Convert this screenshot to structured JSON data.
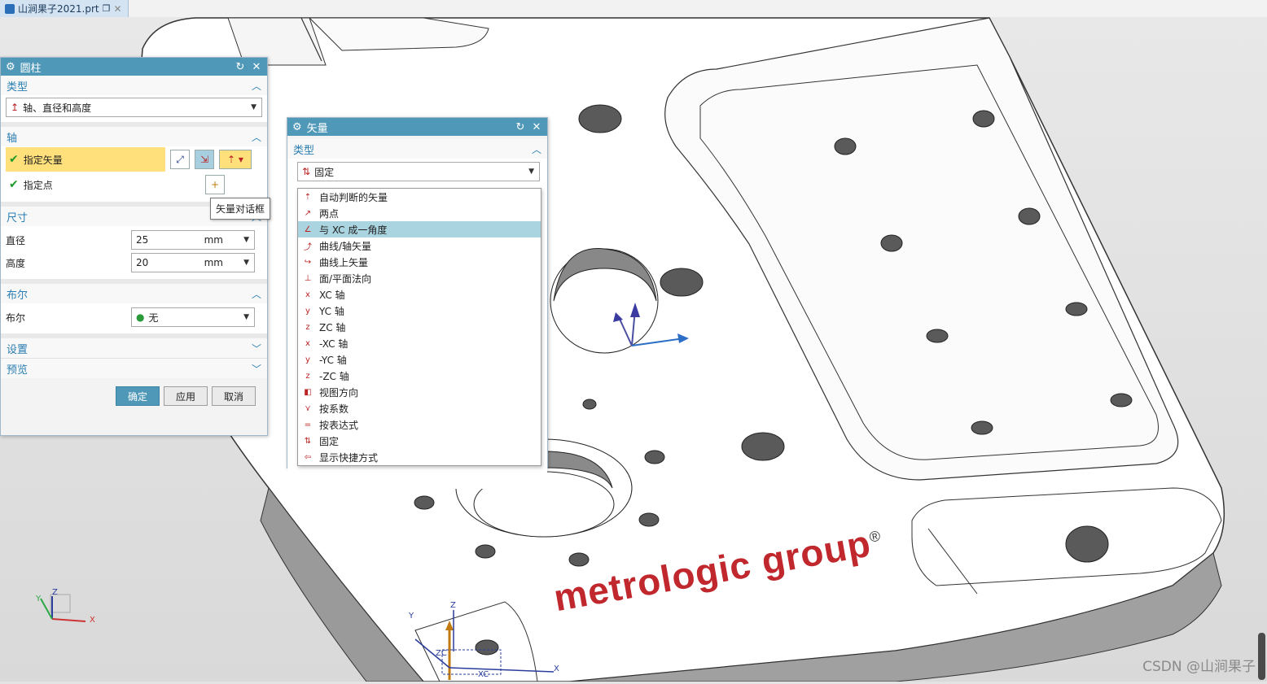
{
  "tab": {
    "title": "山涧果子2021.prt"
  },
  "cylinder_dialog": {
    "title": "圆柱",
    "type_section": "类型",
    "type_value": "轴、直径和高度",
    "axis_section": "轴",
    "specify_vector": "指定矢量",
    "specify_point": "指定点",
    "dims_section": "尺寸",
    "diameter_label": "直径",
    "diameter_value": "25",
    "diameter_unit": "mm",
    "height_label": "高度",
    "height_value": "20",
    "height_unit": "mm",
    "boolean_section": "布尔",
    "boolean_label": "布尔",
    "boolean_value": "无",
    "settings_section": "设置",
    "preview_section": "预览",
    "ok": "确定",
    "apply": "应用",
    "cancel": "取消"
  },
  "tooltip": "矢量对话框",
  "vector_dialog": {
    "title": "矢量",
    "type_section": "类型",
    "type_value": "固定",
    "options": [
      {
        "label": "自动判断的矢量",
        "icon": "auto-vector-icon"
      },
      {
        "label": "两点",
        "icon": "two-points-icon"
      },
      {
        "label": "与 XC 成一角度",
        "icon": "angle-xc-icon"
      },
      {
        "label": "曲线/轴矢量",
        "icon": "curve-axis-icon"
      },
      {
        "label": "曲线上矢量",
        "icon": "on-curve-icon"
      },
      {
        "label": "面/平面法向",
        "icon": "face-normal-icon"
      },
      {
        "label": "XC 轴",
        "icon": "xc-axis-icon"
      },
      {
        "label": "YC 轴",
        "icon": "yc-axis-icon"
      },
      {
        "label": "ZC 轴",
        "icon": "zc-axis-icon"
      },
      {
        "label": "-XC 轴",
        "icon": "neg-xc-axis-icon"
      },
      {
        "label": "-YC 轴",
        "icon": "neg-yc-axis-icon"
      },
      {
        "label": "-ZC 轴",
        "icon": "neg-zc-axis-icon"
      },
      {
        "label": "视图方向",
        "icon": "view-direction-icon"
      },
      {
        "label": "按系数",
        "icon": "by-coefficients-icon"
      },
      {
        "label": "按表达式",
        "icon": "by-expression-icon"
      },
      {
        "label": "固定",
        "icon": "fixed-icon"
      },
      {
        "label": "显示快捷方式",
        "icon": "show-shortcuts-icon"
      }
    ],
    "selected_index": 2
  },
  "model": {
    "brand": "metrologic group",
    "reg": "®"
  },
  "triad": {
    "x": "X",
    "y": "Y",
    "z": "Z"
  },
  "wcs": {
    "xc": "XC",
    "zc": "ZC",
    "x": "X",
    "y": "Y",
    "z": "Z"
  },
  "watermark": "CSDN @山涧果子",
  "colors": {
    "header": "#4f98b7",
    "section": "#2a7db1",
    "highlight": "#ffe07a",
    "selected": "#aad4e0"
  }
}
